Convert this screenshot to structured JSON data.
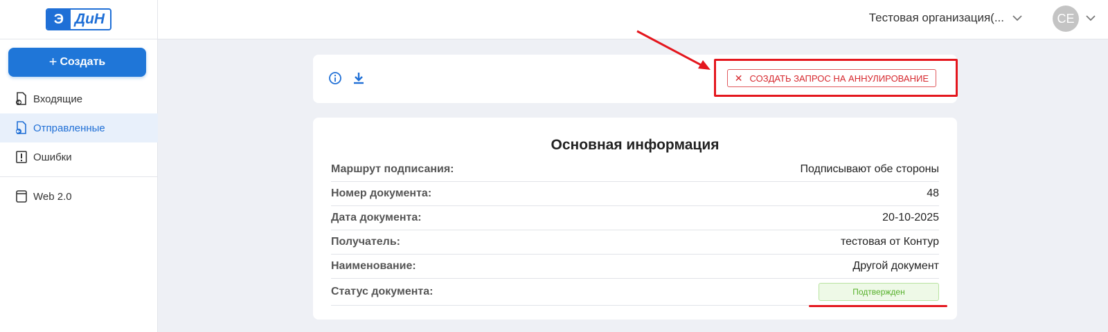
{
  "brand": {
    "logo_letter": "Э",
    "logo_text": "ДиН"
  },
  "sidebar": {
    "create_label": "Создать",
    "items": [
      {
        "label": "Входящие",
        "icon": "inbox-doc-icon",
        "active": false
      },
      {
        "label": "Отправленные",
        "icon": "sent-doc-icon",
        "active": true
      },
      {
        "label": "Ошибки",
        "icon": "error-doc-icon",
        "active": false
      },
      {
        "label": "Web 2.0",
        "icon": "window-icon",
        "active": false
      }
    ]
  },
  "header": {
    "organization": "Тестовая организация(...",
    "avatar_initials": "CE"
  },
  "toolbar": {
    "icons": [
      "info-icon",
      "download-icon"
    ],
    "annul_button_label": "СОЗДАТЬ ЗАПРОС НА АННУЛИРОВАНИЕ"
  },
  "info": {
    "title": "Основная информация",
    "rows": [
      {
        "label": "Маршрут подписания:",
        "value": "Подписывают обе стороны"
      },
      {
        "label": "Номер документа:",
        "value": "48"
      },
      {
        "label": "Дата документа:",
        "value": "20-10-2025"
      },
      {
        "label": "Получатель:",
        "value": "тестовая от Контур"
      },
      {
        "label": "Наименование:",
        "value": "Другой документ"
      },
      {
        "label": "Статус документа:",
        "value": "Подтвержден"
      }
    ]
  },
  "colors": {
    "accent": "#1f76d8",
    "annotation_red": "#e4161d",
    "status_green": "#56b02a"
  }
}
